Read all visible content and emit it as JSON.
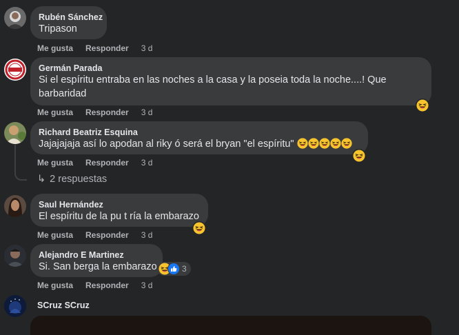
{
  "comments": [
    {
      "author": "Rubén Sánchez",
      "text": "Tripason",
      "like": "Me gusta",
      "reply": "Responder",
      "time": "3 d"
    },
    {
      "author": "Germán Parada",
      "text_line1": "Si el espíritu entraba en las noches a la casa y la poseia toda la noche....! Que",
      "text_line2": "barbaridad",
      "like": "Me gusta",
      "reply": "Responder",
      "time": "3 d"
    },
    {
      "author": "Richard Beatriz Esquina",
      "text": "Jajajajaja así lo apodan al riky ó será el bryan \"el espíritu\"",
      "like": "Me gusta",
      "reply": "Responder",
      "time": "3 d",
      "replies_label": "2 respuestas"
    },
    {
      "author": "Saul Hernández",
      "text": "El espíritu de la pu t ría la embarazo",
      "like": "Me gusta",
      "reply": "Responder",
      "time": "3 d"
    },
    {
      "author": "Alejandro E Martinez",
      "text": "Si. San berga la embarazo",
      "reaction_count": "3",
      "like": "Me gusta",
      "reply": "Responder",
      "time": "3 d"
    },
    {
      "author": "SCruz SCruz"
    }
  ],
  "icons": {
    "laugh": "laughing-emoji-icon",
    "like": "like-reaction-icon",
    "reply_arrow": "reply-arrow-icon"
  },
  "colors": {
    "background": "#242526",
    "bubble": "#3a3b3c",
    "secondary_text": "#b0b3b8",
    "like_blue": "#1877f2",
    "emoji_yellow": "#f7c42e"
  }
}
